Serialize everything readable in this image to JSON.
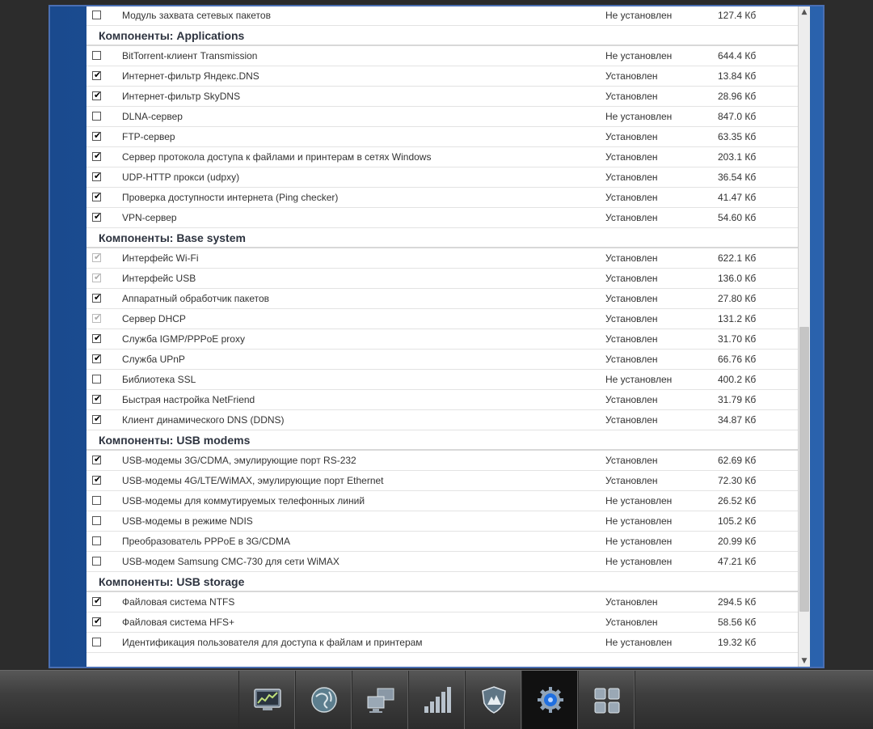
{
  "sections": [
    {
      "title": "",
      "rows": [
        {
          "checked": false,
          "disabled": false,
          "name": "Модуль захвата сетевых пакетов",
          "status": "Не установлен",
          "size": "127.4 Кб"
        }
      ]
    },
    {
      "title": "Компоненты: Applications",
      "rows": [
        {
          "checked": false,
          "disabled": false,
          "name": "BitTorrent-клиент Transmission",
          "status": "Не установлен",
          "size": "644.4 Кб"
        },
        {
          "checked": true,
          "disabled": false,
          "name": "Интернет-фильтр Яндекс.DNS",
          "status": "Установлен",
          "size": "13.84 Кб"
        },
        {
          "checked": true,
          "disabled": false,
          "name": "Интернет-фильтр SkyDNS",
          "status": "Установлен",
          "size": "28.96 Кб"
        },
        {
          "checked": false,
          "disabled": false,
          "name": "DLNA-сервер",
          "status": "Не установлен",
          "size": "847.0 Кб"
        },
        {
          "checked": true,
          "disabled": false,
          "name": "FTP-сервер",
          "status": "Установлен",
          "size": "63.35 Кб"
        },
        {
          "checked": true,
          "disabled": false,
          "name": "Сервер протокола доступа к файлами и принтерам в сетях Windows",
          "status": "Установлен",
          "size": "203.1 Кб"
        },
        {
          "checked": true,
          "disabled": false,
          "name": "UDP-HTTP прокси (udpxy)",
          "status": "Установлен",
          "size": "36.54 Кб"
        },
        {
          "checked": true,
          "disabled": false,
          "name": "Проверка доступности интернета (Ping checker)",
          "status": "Установлен",
          "size": "41.47 Кб"
        },
        {
          "checked": true,
          "disabled": false,
          "name": "VPN-сервер",
          "status": "Установлен",
          "size": "54.60 Кб"
        }
      ]
    },
    {
      "title": "Компоненты: Base system",
      "rows": [
        {
          "checked": true,
          "disabled": true,
          "name": "Интерфейс Wi-Fi",
          "status": "Установлен",
          "size": "622.1 Кб"
        },
        {
          "checked": true,
          "disabled": true,
          "name": "Интерфейс USB",
          "status": "Установлен",
          "size": "136.0 Кб"
        },
        {
          "checked": true,
          "disabled": false,
          "name": "Аппаратный обработчик пакетов",
          "status": "Установлен",
          "size": "27.80 Кб"
        },
        {
          "checked": true,
          "disabled": true,
          "name": "Сервер DHCP",
          "status": "Установлен",
          "size": "131.2 Кб"
        },
        {
          "checked": true,
          "disabled": false,
          "name": "Служба IGMP/PPPoE proxy",
          "status": "Установлен",
          "size": "31.70 Кб"
        },
        {
          "checked": true,
          "disabled": false,
          "name": "Служба UPnP",
          "status": "Установлен",
          "size": "66.76 Кб"
        },
        {
          "checked": false,
          "disabled": false,
          "name": "Библиотека SSL",
          "status": "Не установлен",
          "size": "400.2 Кб"
        },
        {
          "checked": true,
          "disabled": false,
          "name": "Быстрая настройка NetFriend",
          "status": "Установлен",
          "size": "31.79 Кб"
        },
        {
          "checked": true,
          "disabled": false,
          "name": "Клиент динамического DNS (DDNS)",
          "status": "Установлен",
          "size": "34.87 Кб"
        }
      ]
    },
    {
      "title": "Компоненты: USB modems",
      "rows": [
        {
          "checked": true,
          "disabled": false,
          "name": "USB-модемы 3G/CDMA, эмулирующие порт RS-232",
          "status": "Установлен",
          "size": "62.69 Кб"
        },
        {
          "checked": true,
          "disabled": false,
          "name": "USB-модемы 4G/LTE/WiMAX, эмулирующие порт Ethernet",
          "status": "Установлен",
          "size": "72.30 Кб"
        },
        {
          "checked": false,
          "disabled": false,
          "name": "USB-модемы для коммутируемых телефонных линий",
          "status": "Не установлен",
          "size": "26.52 Кб"
        },
        {
          "checked": false,
          "disabled": false,
          "name": "USB-модемы в режиме NDIS",
          "status": "Не установлен",
          "size": "105.2 Кб"
        },
        {
          "checked": false,
          "disabled": false,
          "name": "Преобразователь PPPoE в 3G/CDMA",
          "status": "Не установлен",
          "size": "20.99 Кб"
        },
        {
          "checked": false,
          "disabled": false,
          "name": "USB-модем Samsung CMC-730 для сети WiMAX",
          "status": "Не установлен",
          "size": "47.21 Кб"
        }
      ]
    },
    {
      "title": "Компоненты: USB storage",
      "rows": [
        {
          "checked": true,
          "disabled": false,
          "name": "Файловая система NTFS",
          "status": "Установлен",
          "size": "294.5 Кб"
        },
        {
          "checked": true,
          "disabled": false,
          "name": "Файловая система HFS+",
          "status": "Установлен",
          "size": "58.56 Кб"
        },
        {
          "checked": false,
          "disabled": false,
          "name": "Идентификация пользователя для доступа к файлам и принтерам",
          "status": "Не установлен",
          "size": "19.32 Кб"
        }
      ]
    }
  ],
  "scrollbar": {
    "up_arrow": "▲",
    "down_arrow": "▼"
  },
  "taskbar": {
    "items": [
      {
        "icon": "monitor-chart-icon",
        "active": false
      },
      {
        "icon": "globe-icon",
        "active": false
      },
      {
        "icon": "network-computers-icon",
        "active": false
      },
      {
        "icon": "signal-bars-icon",
        "active": false
      },
      {
        "icon": "shield-icon",
        "active": false
      },
      {
        "icon": "gear-icon",
        "active": true
      },
      {
        "icon": "apps-grid-icon",
        "active": false
      }
    ]
  }
}
